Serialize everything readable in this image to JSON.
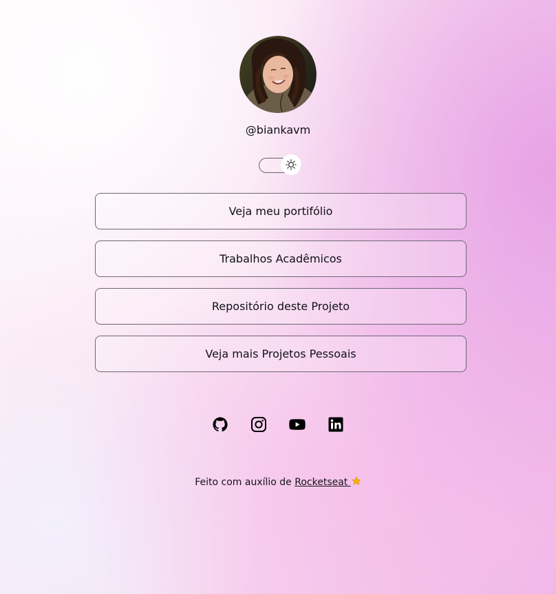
{
  "profile": {
    "handle": "@biankavm"
  },
  "theme_toggle": {
    "state": "light",
    "icon": "sun-icon"
  },
  "links": [
    {
      "label": "Veja meu portifólio"
    },
    {
      "label": "Trabalhos Acadêmicos"
    },
    {
      "label": "Repositório deste Projeto"
    },
    {
      "label": "Veja mais Projetos Pessoais"
    }
  ],
  "social": [
    {
      "icon": "github-icon"
    },
    {
      "icon": "instagram-icon"
    },
    {
      "icon": "youtube-icon"
    },
    {
      "icon": "linkedin-icon"
    }
  ],
  "footer": {
    "text": "Feito com auxílio de",
    "link_label": "Rocketseat",
    "emoji_icon": "star-icon"
  },
  "colors": {
    "accent_pink": "#e7a0e6",
    "text": "#0f0f16",
    "button_border": "#6f6675",
    "star": "#f4b400"
  }
}
